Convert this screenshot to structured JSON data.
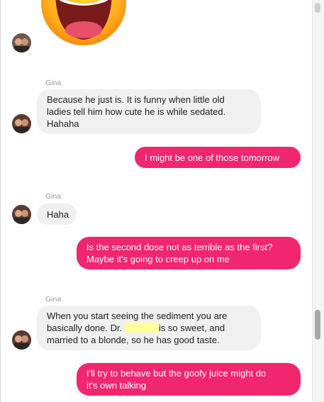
{
  "messages": [
    {
      "sender": "Gina",
      "lines": [
        "Because he just is. It is funny when little old",
        "ladies tell him how cute he is while sedated.",
        "Hahaha"
      ]
    },
    {
      "lines": [
        "I might be one of those tomorrow"
      ]
    },
    {
      "sender": "Gina",
      "lines": [
        "Haha"
      ]
    },
    {
      "lines": [
        "Is the second dose not as terrible as the first?",
        "Maybe it's going to creep up on me"
      ]
    },
    {
      "sender": "Gina",
      "line1": "When you start seeing the sediment you are",
      "line2_before": "basically done. Dr.",
      "line2_after": "is so sweet,  and",
      "line3": "married to a blonde,  so he has good taste."
    },
    {
      "lines": [
        "I'll try to behave but the goofy juice might do",
        "it's own talking"
      ]
    }
  ],
  "colors": {
    "outgoing_bubble": "#f0266e",
    "incoming_bubble": "#f1f0f0",
    "sender_name": "#999999",
    "redaction_highlight": "#ffff99"
  },
  "icons": {
    "reaction": "laughing-tears-emoji-icon",
    "contact": "avatar"
  }
}
